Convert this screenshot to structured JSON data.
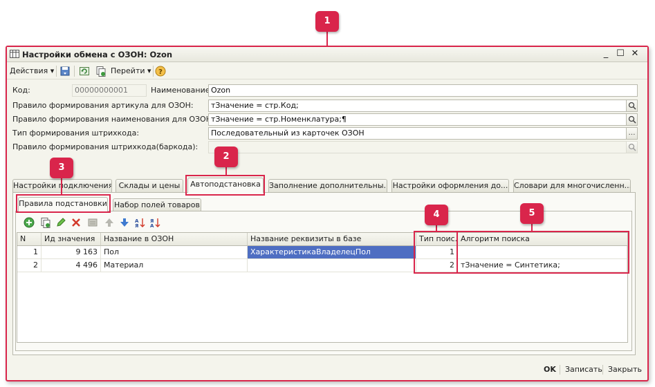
{
  "window": {
    "title": "Настройки обмена с ОЗОН: Ozon"
  },
  "toolbar": {
    "actions_label": "Действия",
    "goto_label": "Перейти"
  },
  "form": {
    "code_label": "Код:",
    "code_value": "00000000001",
    "name_label": "Наименование:",
    "name_value": "Ozon",
    "sku_rule_label": "Правило формирования артикула для ОЗОН:",
    "sku_rule_value": "тЗначение =  стр.Код;",
    "name_rule_label": "Правило формирования наименования для ОЗОН:",
    "name_rule_value": "тЗначение =  стр.Номенклатура;¶",
    "barcode_type_label": "Тип формирования штрихкода:",
    "barcode_type_value": "Последовательный из карточек ОЗОН",
    "barcode_rule_label": "Правило формирования штрихкода(баркода):",
    "barcode_rule_value": ""
  },
  "tabs": [
    {
      "label": "Настройки подключения"
    },
    {
      "label": "Склады и цены"
    },
    {
      "label": "Автоподстановка"
    },
    {
      "label": "Заполнение дополнительны..."
    },
    {
      "label": "Настройки оформления до..."
    },
    {
      "label": "Словари для многочисленн..."
    }
  ],
  "subtabs": [
    {
      "label": "Правила подстановки"
    },
    {
      "label": "Набор полей товаров"
    }
  ],
  "grid": {
    "columns": [
      "N",
      "Ид значения",
      "Название в ОЗОН",
      "Название реквизиты в базе",
      "Тип поис...",
      "Алгоритм поиска"
    ],
    "rows": [
      {
        "n": "1",
        "id": "9 163",
        "ozon": "Пол",
        "base": "ХарактеристикаВладелецПол",
        "type": "1",
        "algo": ""
      },
      {
        "n": "2",
        "id": "4 496",
        "ozon": "Материал",
        "base": "",
        "type": "2",
        "algo": "тЗначение = Синтетика;"
      }
    ]
  },
  "footer": {
    "ok_label": "OK",
    "save_label": "Записать",
    "close_label": "Закрыть"
  },
  "callouts": [
    "1",
    "2",
    "3",
    "4",
    "5"
  ],
  "colors": {
    "accent": "#d9254b",
    "selection": "#4e6ec2"
  }
}
